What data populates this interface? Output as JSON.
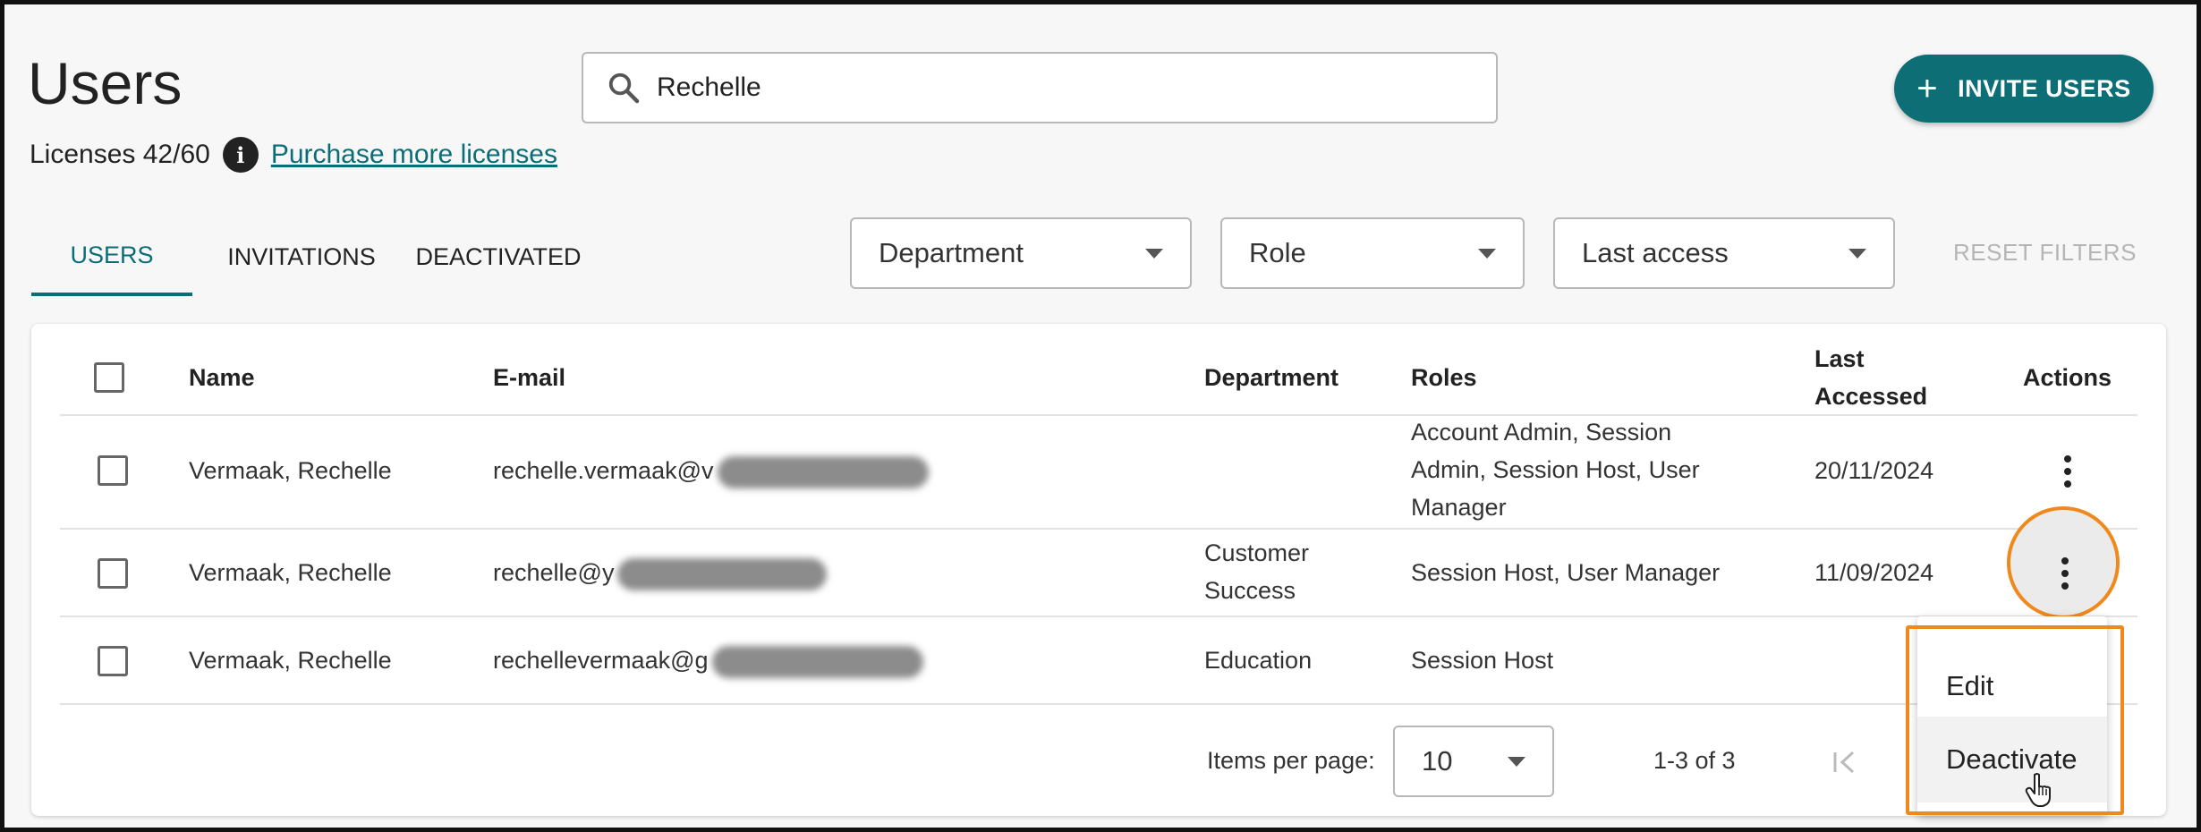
{
  "header": {
    "title": "Users",
    "licenses_text": "Licenses 42/60",
    "purchase_link": "Purchase more licenses"
  },
  "search": {
    "value": "Rechelle",
    "placeholder": ""
  },
  "invite_button": {
    "label": "INVITE USERS"
  },
  "tabs": [
    {
      "label": "USERS",
      "active": true
    },
    {
      "label": "INVITATIONS",
      "active": false
    },
    {
      "label": "DEACTIVATED",
      "active": false
    }
  ],
  "filters": {
    "department": "Department",
    "role": "Role",
    "last_access": "Last access",
    "reset_label": "RESET FILTERS"
  },
  "table": {
    "columns": {
      "name": "Name",
      "email": "E-mail",
      "department": "Department",
      "roles": "Roles",
      "last_accessed_1": "Last",
      "last_accessed_2": "Accessed",
      "actions": "Actions"
    },
    "rows": [
      {
        "name": "Vermaak, Rechelle",
        "email": "rechelle.vermaak@v",
        "department_1": "",
        "department_2": "",
        "roles_lines": [
          "Account Admin, Session",
          "Admin, Session Host, User",
          "Manager"
        ],
        "last_accessed": "20/11/2024"
      },
      {
        "name": "Vermaak, Rechelle",
        "email": "rechelle@y",
        "department_1": "Customer",
        "department_2": "Success",
        "roles_lines": [
          "Session Host, User Manager"
        ],
        "last_accessed": "11/09/2024"
      },
      {
        "name": "Vermaak, Rechelle",
        "email": "rechellevermaak@g",
        "department_1": "Education",
        "department_2": "",
        "roles_lines": [
          "Session Host"
        ],
        "last_accessed": ""
      }
    ]
  },
  "actions_menu": {
    "items": [
      "Edit",
      "Deactivate"
    ],
    "hovered": "Deactivate"
  },
  "pagination": {
    "items_per_page_label": "Items per page:",
    "items_per_page_value": "10",
    "range_text": "1-3 of 3"
  },
  "colors": {
    "accent": "#0e6e76",
    "highlight": "#f0891c"
  },
  "icons": [
    "search-icon",
    "info-icon",
    "plus-icon",
    "chevron-down-icon",
    "more-vertical-icon",
    "first-page-icon",
    "hand-cursor-icon"
  ]
}
